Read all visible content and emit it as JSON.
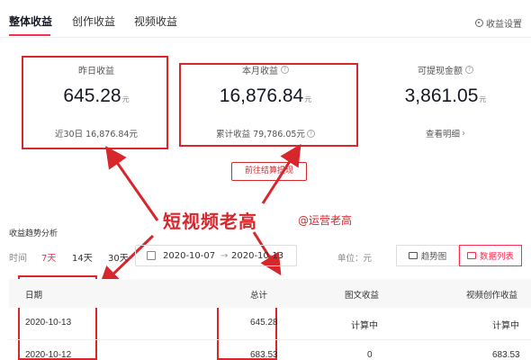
{
  "tabs": [
    "整体收益",
    "创作收益",
    "视频收益"
  ],
  "settings_label": "收益设置",
  "cards": [
    {
      "title": "昨日收益",
      "value": "645.28",
      "unit": "元",
      "sub": "近30日 16,876.84元"
    },
    {
      "title": "本月收益",
      "value": "16,876.84",
      "unit": "元",
      "sub": "累计收益 79,786.05元"
    },
    {
      "title": "可提现金额",
      "value": "3,861.05",
      "unit": "元",
      "sub": "查看明细"
    }
  ],
  "settle_button": "前往结算提现",
  "annotation": {
    "main": "短视频老高",
    "handle": "@运营老高"
  },
  "trend": {
    "title": "收益趋势分析",
    "time_label": "时间",
    "ranges": [
      "7天",
      "14天",
      "30天"
    ],
    "active_range": "7天",
    "date_start": "2020-10-07",
    "date_sep": "→",
    "date_end": "2020-10-13",
    "unit": "单位：元",
    "view_chart": "趋势图",
    "view_table": "数据列表"
  },
  "table": {
    "headers": [
      "日期",
      "总计",
      "图文收益",
      "视频创作收益"
    ],
    "rows": [
      [
        "2020-10-13",
        "645.28",
        "计算中",
        "计算中"
      ],
      [
        "2020-10-12",
        "683.53",
        "0",
        "683.53"
      ]
    ]
  },
  "colors": {
    "accent": "#fe2c55",
    "annotation_red": "#d7262c"
  }
}
